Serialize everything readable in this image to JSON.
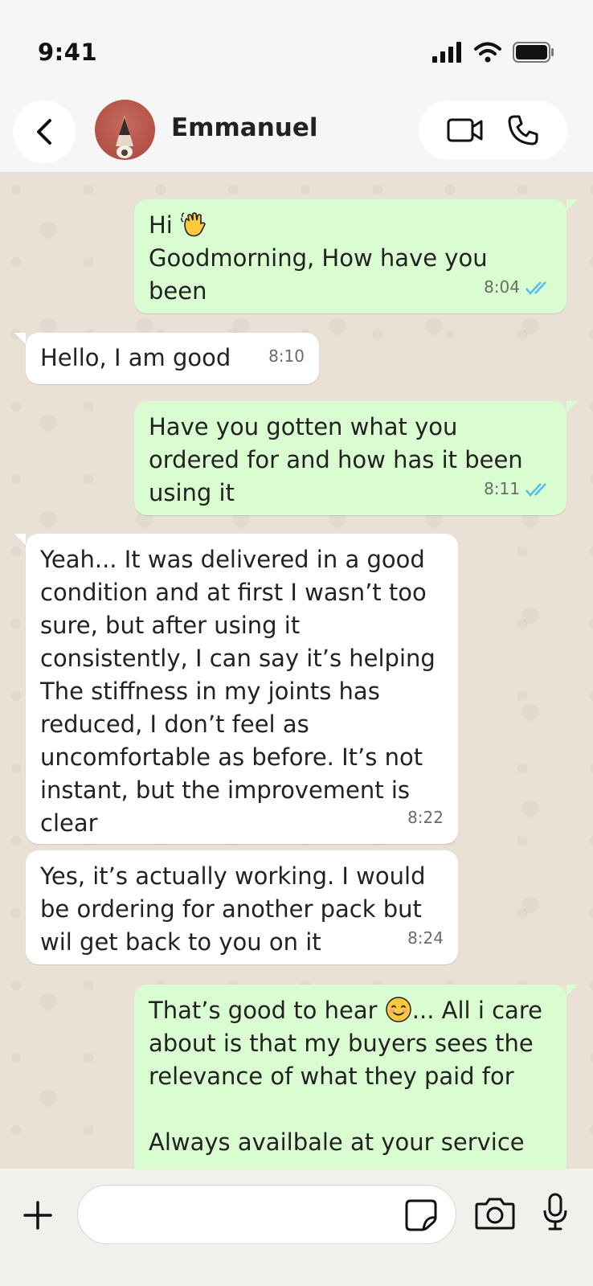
{
  "status_bar": {
    "time": "9:41"
  },
  "header": {
    "contact_name": "Emmanuel"
  },
  "messages": [
    {
      "direction": "out",
      "text": "Hi",
      "text2": "Goodmorning, How have you been",
      "time": "8:04",
      "read": true
    },
    {
      "direction": "in",
      "text": "Hello, I am good",
      "time": "8:10"
    },
    {
      "direction": "out",
      "text": "Have you gotten what you ordered for and how has it been using it",
      "time": "8:11",
      "read": true
    },
    {
      "direction": "in",
      "text": "Yeah... It was delivered in a good condition and at first I wasn’t too sure, but after using it consistently, I can say it’s helping\nThe stiffness in my joints has reduced, I don’t feel as uncomfortable as before. It’s not instant, but the improvement is clear",
      "time": "8:22"
    },
    {
      "direction": "in",
      "text": "Yes, it’s actually working. I would be ordering for another pack but wil get back to you on it",
      "time": "8:24"
    },
    {
      "direction": "out",
      "text_before_emoji": "That’s good to hear ",
      "text_after_emoji": "... All i care about is that my buyers sees the relevance of what they paid for\n\nAlways availbale at your service"
    }
  ],
  "composer": {
    "placeholder": "",
    "value": ""
  },
  "colors": {
    "outgoing_bubble": "#dafcd1",
    "incoming_bubble": "#ffffff",
    "read_ticks": "#53bdeb",
    "chat_bg": "#e9e1d6"
  }
}
